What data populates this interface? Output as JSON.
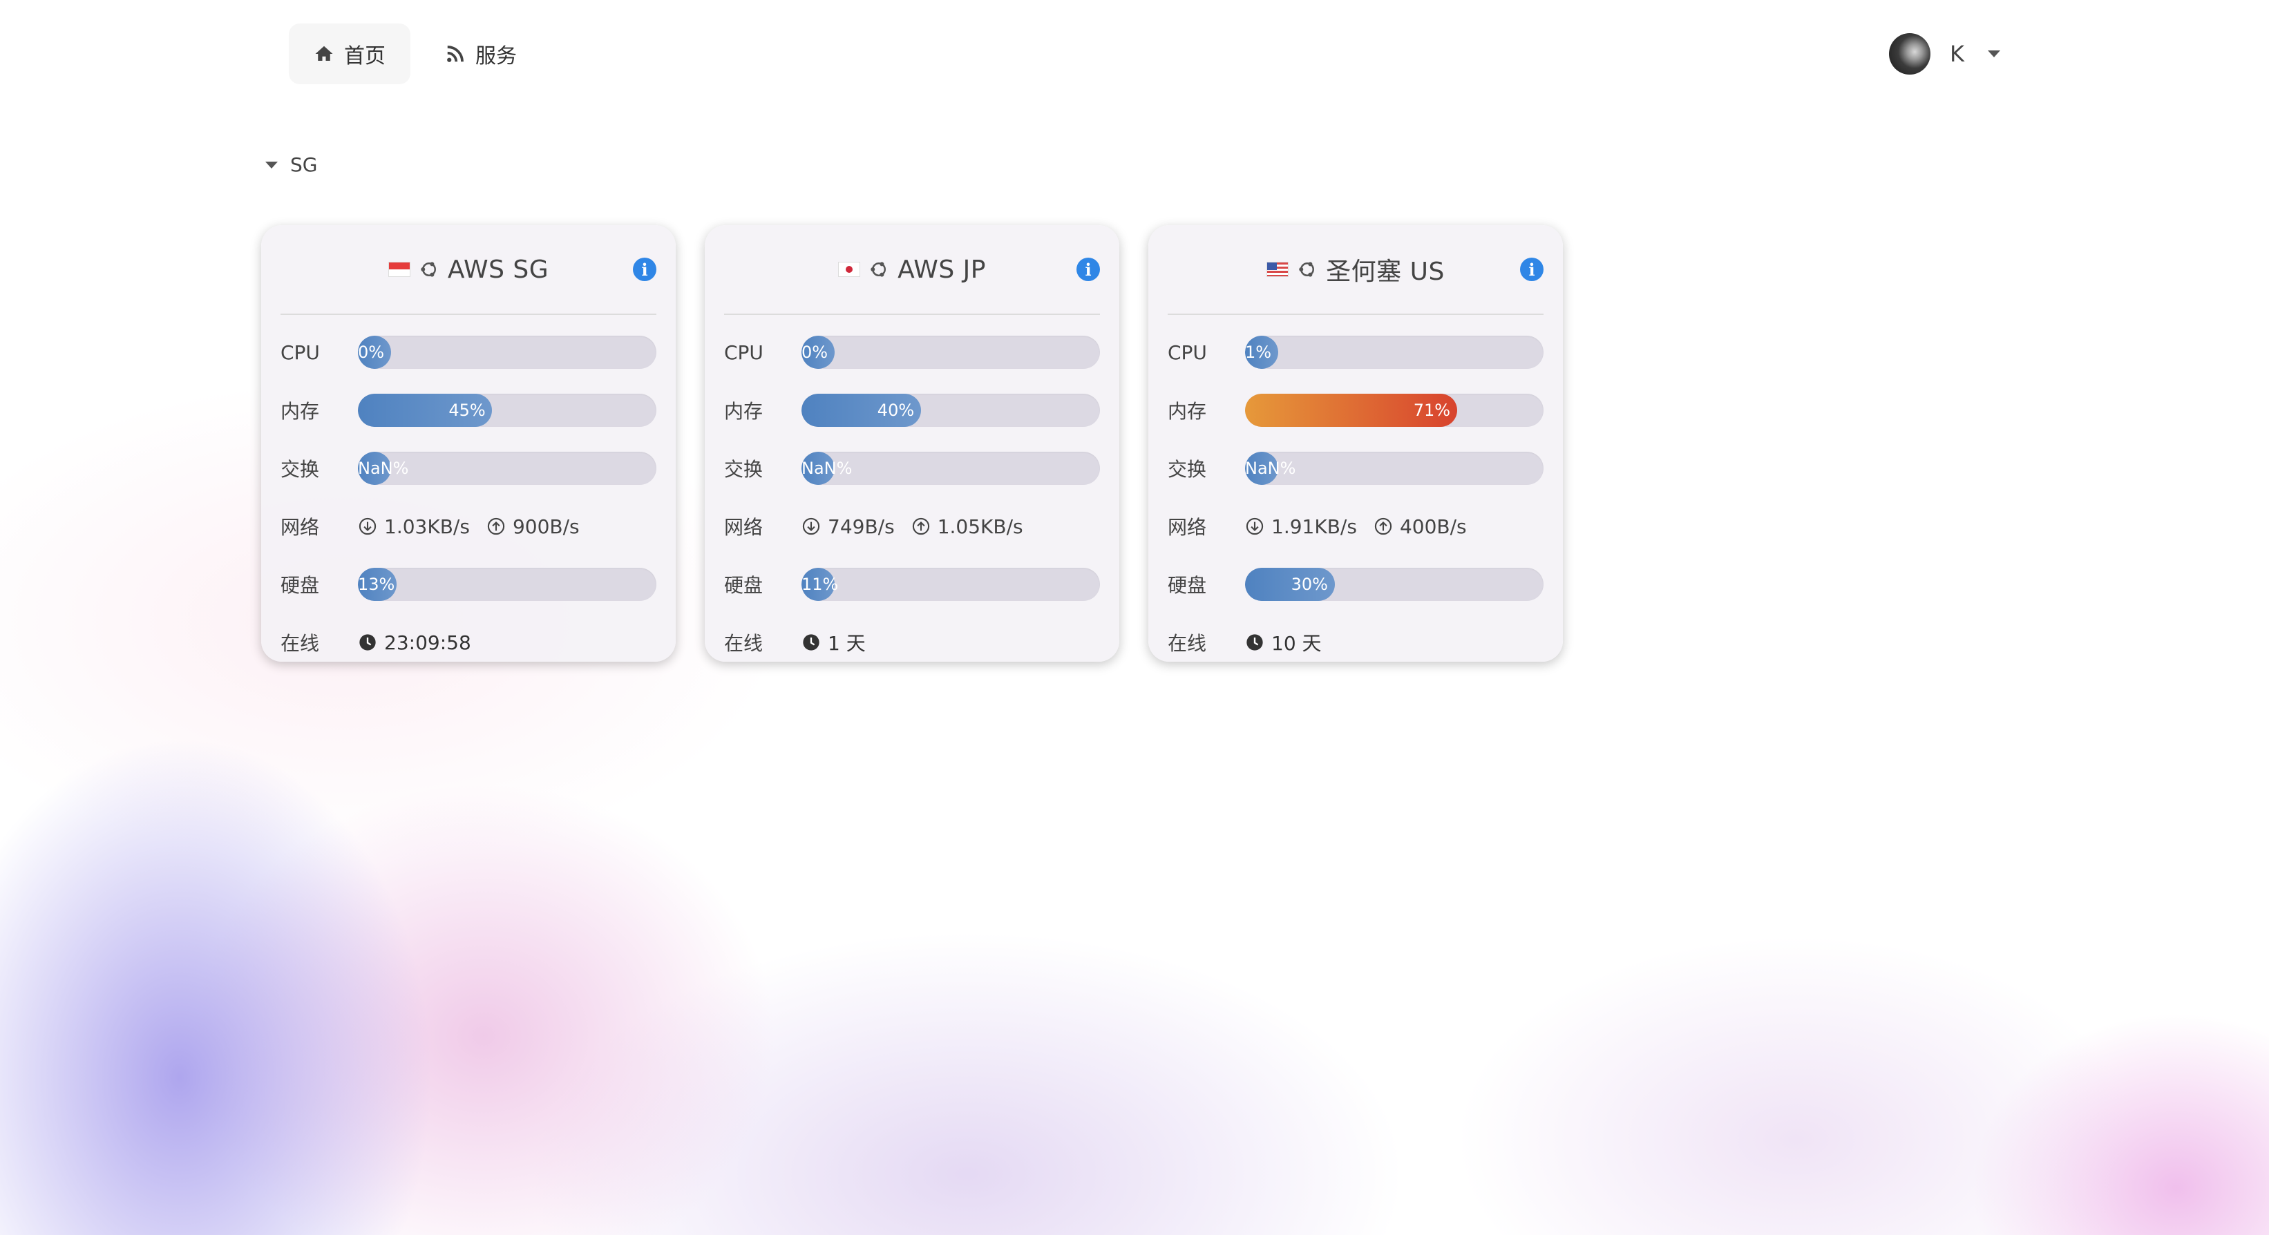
{
  "nav": {
    "items": [
      {
        "label": "首页",
        "icon": "home-icon",
        "active": true
      },
      {
        "label": "服务",
        "icon": "rss-icon",
        "active": false
      }
    ]
  },
  "user": {
    "name": "K"
  },
  "group": {
    "name": "SG"
  },
  "labels": {
    "cpu": "CPU",
    "memory": "内存",
    "swap": "交换",
    "network": "网络",
    "disk": "硬盘",
    "uptime": "在线"
  },
  "servers": [
    {
      "name": "AWS SG",
      "flag": "SG",
      "os_icon": "ubuntu-icon",
      "cpu": "0%",
      "cpu_value": 0,
      "memory": "45%",
      "memory_value": 45,
      "swap": "NaN%",
      "net_down": "1.03KB/s",
      "net_up": "900B/s",
      "disk": "13%",
      "disk_value": 13,
      "uptime": "23:09:58"
    },
    {
      "name": "AWS JP",
      "flag": "JP",
      "os_icon": "ubuntu-icon",
      "cpu": "0%",
      "cpu_value": 0,
      "memory": "40%",
      "memory_value": 40,
      "swap": "NaN%",
      "net_down": "749B/s",
      "net_up": "1.05KB/s",
      "disk": "11%",
      "disk_value": 11,
      "uptime": "1 天"
    },
    {
      "name": "圣何塞 US",
      "flag": "US",
      "os_icon": "ubuntu-icon",
      "cpu": "1%",
      "cpu_value": 1,
      "memory": "71%",
      "memory_value": 71,
      "swap": "NaN%",
      "net_down": "1.91KB/s",
      "net_up": "400B/s",
      "disk": "30%",
      "disk_value": 30,
      "uptime": "10 天"
    }
  ],
  "colors": {
    "bar_fill": "#4f82c0",
    "bar_warn": "#d8432e",
    "info": "#2f86e6"
  }
}
